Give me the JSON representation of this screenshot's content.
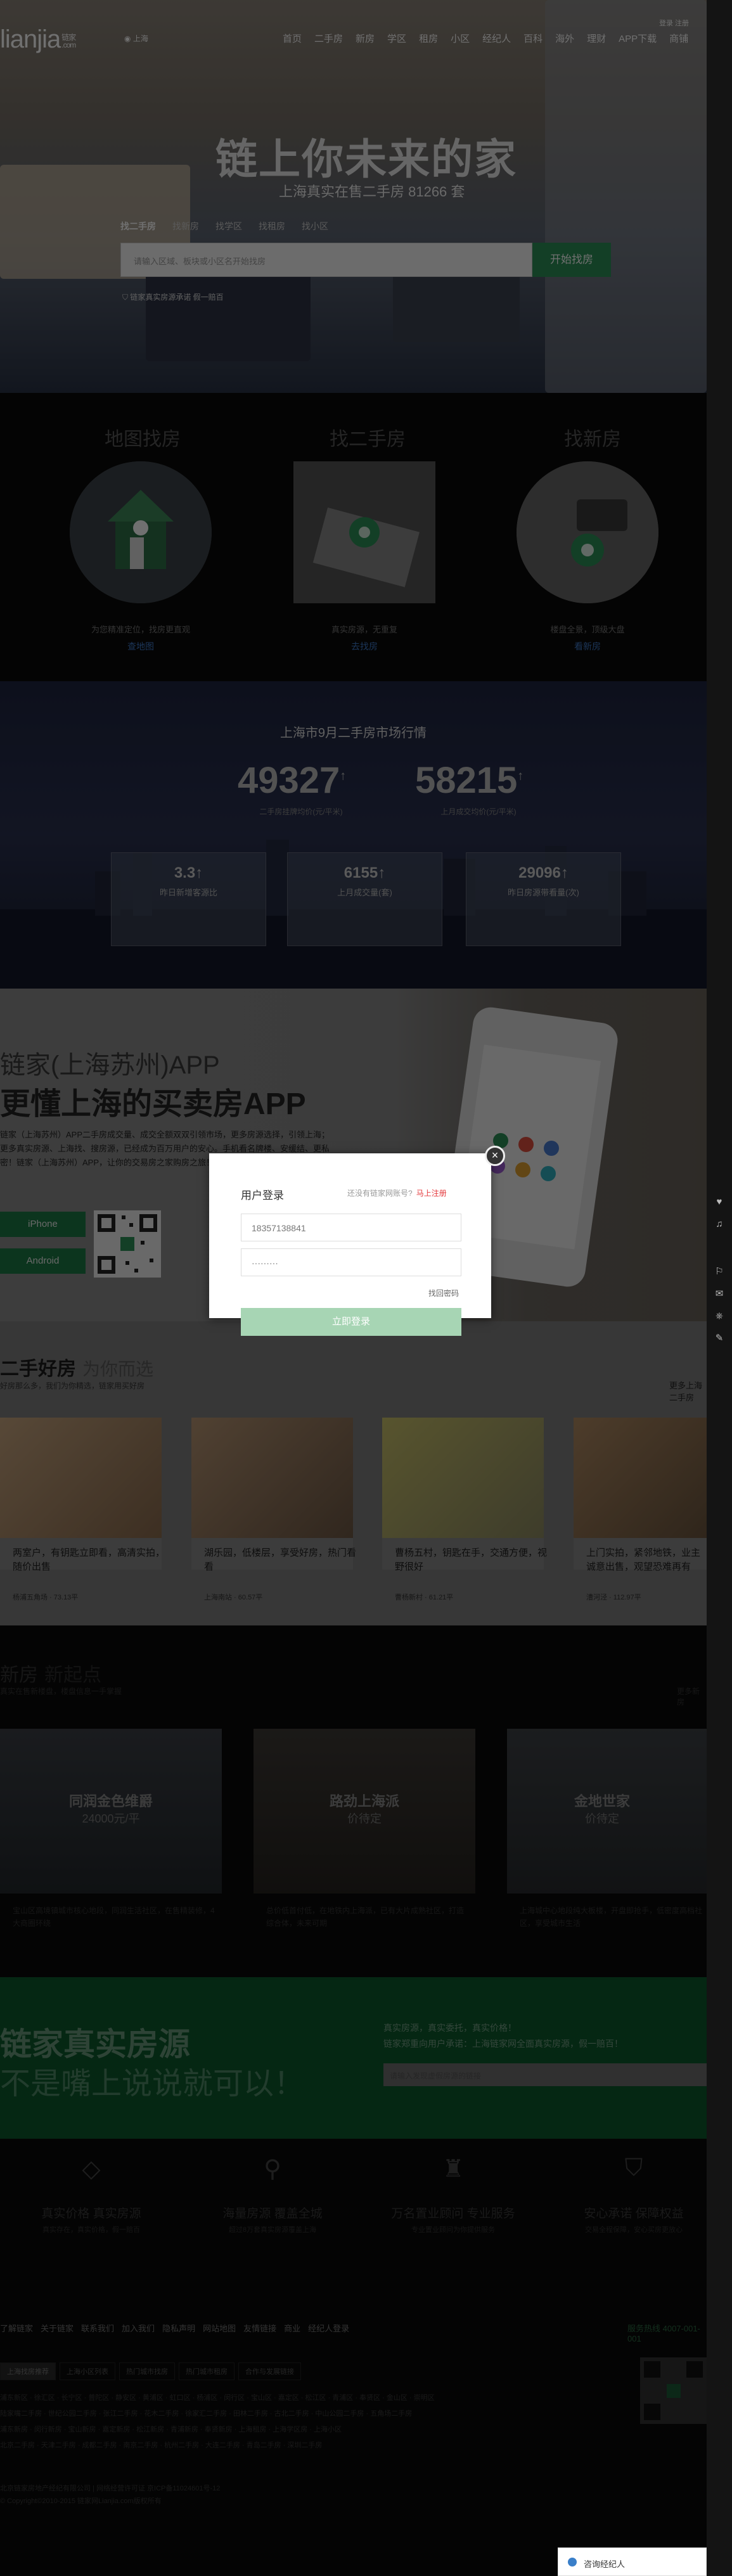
{
  "header": {
    "logo": "lianjia",
    "logo_cn": "链家",
    "logo_com": ".com",
    "city": "上海",
    "nav": [
      "首页",
      "二手房",
      "新房",
      "学区",
      "租房",
      "小区",
      "经纪人",
      "百科",
      "海外",
      "理财",
      "APP下载",
      "商铺"
    ],
    "top_links": "登录  注册"
  },
  "hero": {
    "title": "链上你未来的家",
    "subtitle": "上海真实在售二手房 81266 套",
    "search_tabs": [
      "找二手房",
      "找新房",
      "找学区",
      "找租房",
      "找小区"
    ],
    "search_placeholder": "请输入区域、板块或小区名开始找房",
    "search_button": "开始找房",
    "search_footer": "链家真实房源承诺 假一赔百"
  },
  "features3": [
    {
      "title": "地图找房",
      "desc": "为您精准定位，找房更直观",
      "link": "查地图"
    },
    {
      "title": "找二手房",
      "desc": "真实房源，无重复",
      "link": "去找房"
    },
    {
      "title": "找新房",
      "desc": "楼盘全景，顶级大盘",
      "link": "看新房"
    }
  ],
  "market": {
    "title": "上海市9月二手房市场行情",
    "big": [
      {
        "value": "49327",
        "unit": "↑",
        "cap": "二手房挂牌均价(元/平米)"
      },
      {
        "value": "58215",
        "unit": "↑",
        "cap": "上月成交均价(元/平米)"
      }
    ],
    "boxes": [
      {
        "value": "3.3↑",
        "cap": "昨日新增客源比"
      },
      {
        "value": "6155↑",
        "cap": "上月成交量(套)"
      },
      {
        "value": "29096↑",
        "cap": "昨日房源带看量(次)"
      }
    ]
  },
  "app": {
    "h1": "链家(上海苏州)APP",
    "h2": "更懂上海的买卖房APP",
    "desc": "链家（上海苏州）APP二手房成交量、成交全额双双引领市场，更多房源选择，引领上海；更多真实房源、上海找、搜房源，已经成为百万用户的安心。手机看名牌楼、安缓结、更私密！链家（上海苏州）APP，让你的交易房之家购房之旅！",
    "iphone": "iPhone",
    "android": "Android"
  },
  "secondhand": {
    "title": "二手好房",
    "title2": "为你而选",
    "sub": "好房那么多，我们为你精选，链家用买好房",
    "more": "更多上海二手房",
    "cards": [
      {
        "title": "两室户，有钥匙立即看，高清实拍，随价出售",
        "meta": "杨浦五角场 · 73.13平"
      },
      {
        "title": "湖乐园，低楼层，享受好房，热门看看",
        "meta": "上海南站 · 60.57平"
      },
      {
        "title": "曹杨五村，钥匙在手，交通方便，视野很好",
        "meta": "曹杨新村 · 61.21平"
      },
      {
        "title": "上门实拍，紧邻地铁，业主诚意出售，观望恐难再有",
        "meta": "漕河泾 · 112.97平"
      }
    ]
  },
  "newhomes": {
    "title": "新房",
    "title2": "新起点",
    "sub": "真实在售新楼盘，楼盘信息一手掌握",
    "more": "更多新房",
    "cards": [
      {
        "name": "同润金色维爵",
        "price": "24000元/平",
        "desc": "宝山区高境镇城市核心地段，同润生活社区，在售精装修，4大商圈环绕"
      },
      {
        "name": "路劲上海派",
        "price": "价待定",
        "desc": "总价低首付低，在地铁内上海派，已有大片成熟社区，打造综合体，未来可期"
      },
      {
        "name": "金地世家",
        "price": "价待定",
        "desc": "上海城中心地段纯大板楼，开盘即抢手，低密度高档社区，享受城市生活"
      }
    ]
  },
  "banner": {
    "h1": "链家真实房源",
    "h2": "不是嘴上说说就可以！",
    "r1": "真实房源，真实委托，真实价格！",
    "r2": "链家郑重向用户承诺：上海链家网全面真实房源，假一赔百！",
    "input": "请输入发现虚假房源的链接"
  },
  "promises": [
    {
      "icon": "◇",
      "title": "真实价格 真实房源",
      "sub": "真实存在，真实价格，假一赔百"
    },
    {
      "icon": "⚲",
      "title": "海量房源 覆盖全城",
      "sub": "超过8万套真实房源覆盖上海"
    },
    {
      "icon": "♜",
      "title": "万名置业顾问 专业服务",
      "sub": "专业置业顾问为你提供服务"
    },
    {
      "icon": "⛉",
      "title": "安心承诺 保障权益",
      "sub": "交易全程保障，安心买房更放心"
    }
  ],
  "footer": {
    "nav": [
      "了解链家",
      "关于链家",
      "联系我们",
      "加入我们",
      "隐私声明",
      "网站地图",
      "友情链接",
      "商业",
      "经纪人登录"
    ],
    "tel": "服务热线 4007-001-001",
    "tabs": [
      "上海找房推荐",
      "上海小区列表",
      "热门城市找房",
      "热门城市租房",
      "合作与发展链接"
    ],
    "links1": "浦东新区 · 徐汇区 · 长宁区 · 普陀区 · 静安区 · 黄浦区 · 虹口区 · 杨浦区 · 闵行区 · 宝山区 · 嘉定区 · 松江区 · 青浦区 · 奉贤区 · 金山区 · 崇明区",
    "links2": "陆家嘴二手房 · 世纪公园二手房 · 张江二手房 · 花木二手房 · 徐家汇二手房 · 田林二手房 · 古北二手房 · 中山公园二手房 · 五角场二手房",
    "links3": "浦东新房 · 闵行新房 · 宝山新房 · 嘉定新房 · 松江新房 · 青浦新房 · 奉贤新房 · 上海租房 · 上海学区房 · 上海小区",
    "links4": "北京二手房 · 天津二手房 · 成都二手房 · 南京二手房 · 杭州二手房 · 大连二手房 · 青岛二手房 · 深圳二手房",
    "copy1": "北京链家房地产经纪有限公司 | 网络经营许可证 京ICP备11024601号-12",
    "copy2": "© Copyright©2010-2015 链家网Lianjia.com版权所有"
  },
  "rail": [
    "♥",
    "♫",
    "⚐",
    "✉",
    "⎈",
    "✎"
  ],
  "consult": "咨询经纪人",
  "modal": {
    "title": "用户登录",
    "register_q": "还没有链家网账号?",
    "register": "马上注册",
    "phone": "18357138841",
    "password": "·········",
    "forgot": "找回密码",
    "submit": "立即登录"
  }
}
